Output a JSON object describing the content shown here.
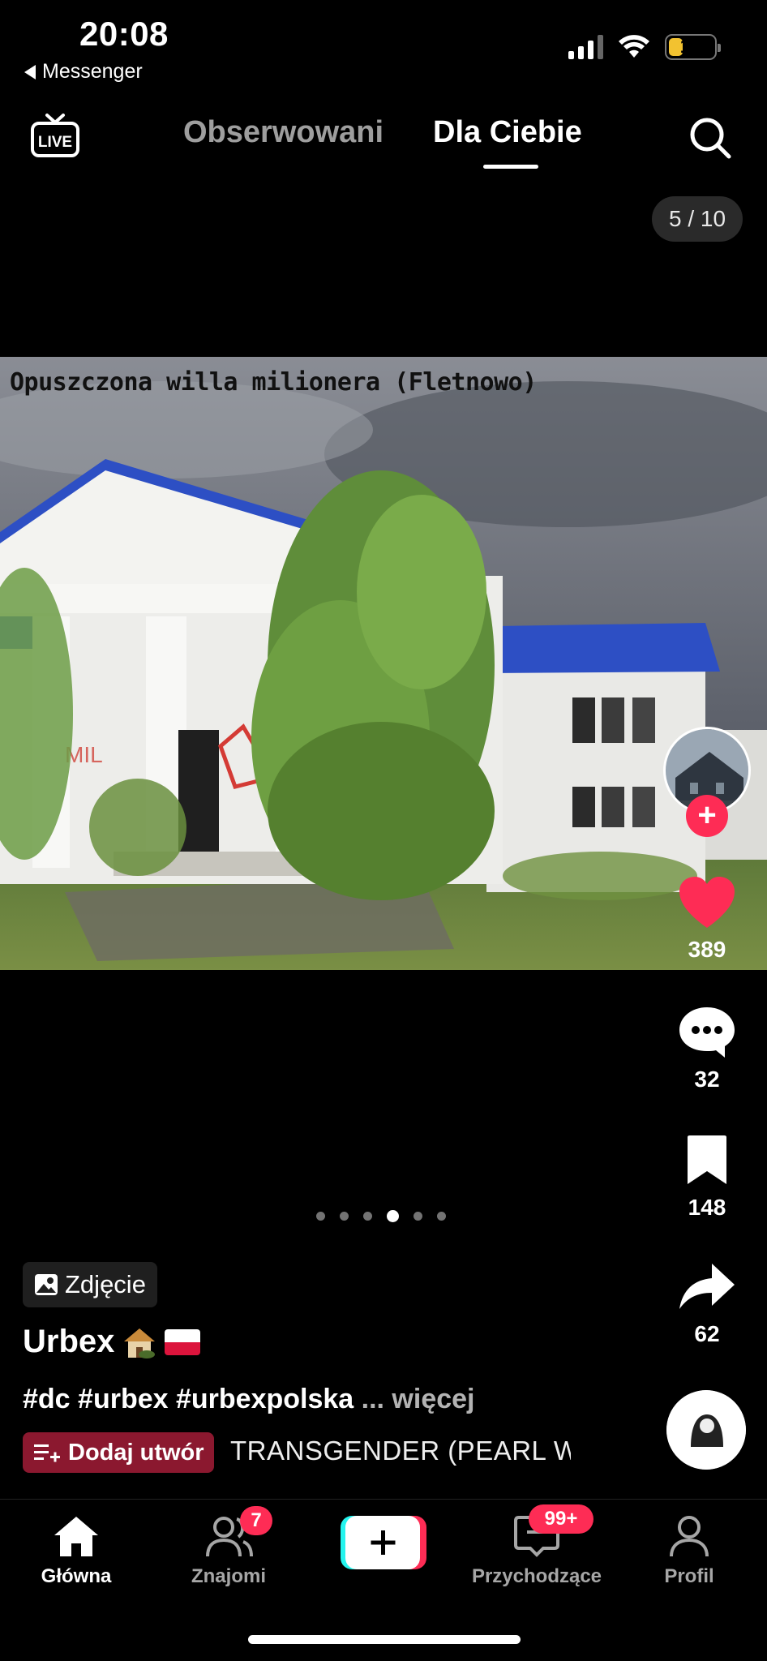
{
  "status_bar": {
    "time": "20:08",
    "back_app": "Messenger",
    "battery": "14"
  },
  "top_nav": {
    "live_label": "LIVE",
    "tabs": [
      {
        "label": "Obserwowani",
        "active": false
      },
      {
        "label": "Dla Ciebie",
        "active": true
      }
    ]
  },
  "photo_counter": "5 / 10",
  "photo": {
    "caption": "Opuszczona willa milionera (Fletnowo)"
  },
  "rail": {
    "likes": "389",
    "comments": "32",
    "saves": "148",
    "shares": "62"
  },
  "carousel": {
    "dot_count": 6,
    "active_index": 3
  },
  "post": {
    "type_badge": "Zdjęcie",
    "username": "Urbex",
    "description": "#dc #urbex #urbexpolska",
    "more_label": "... więcej",
    "add_song_label": "Dodaj utwór",
    "song_title": "TRANSGENDER (PEARL W"
  },
  "bottom_nav": {
    "items": [
      {
        "label": "Główna",
        "active": true
      },
      {
        "label": "Znajomi",
        "badge": "7"
      },
      {
        "label": "Przychodzące",
        "badge": "99+"
      },
      {
        "label": "Profil"
      }
    ]
  },
  "colors": {
    "accent": "#fe2c55",
    "background": "#000000",
    "roof_blue": "#2d4fc4"
  }
}
